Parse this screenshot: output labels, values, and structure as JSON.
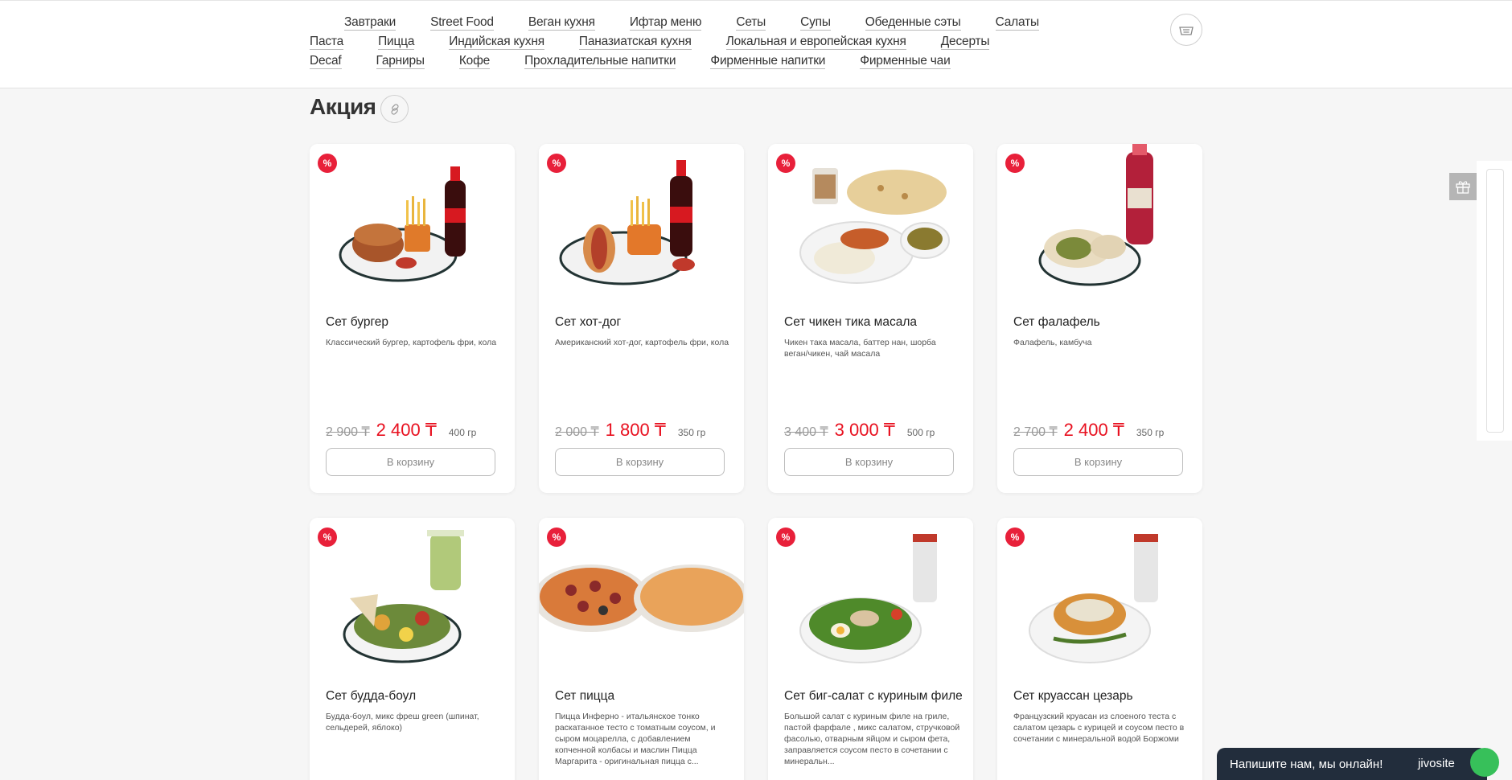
{
  "nav": {
    "row1": [
      "Завтраки",
      "Street Food",
      "Веган кухня",
      "Ифтар меню",
      "Сеты",
      "Супы",
      "Обеденные сэты",
      "Салаты"
    ],
    "row2": [
      "Паста",
      "Пицца",
      "Индийская кухня",
      "Паназиатская кухня",
      "Локальная и европейская кухня",
      "Десерты"
    ],
    "row3": [
      "Decaf",
      "Гарниры",
      "Кофе",
      "Прохладительные напитки",
      "Фирменные напитки",
      "Фирменные чаи"
    ]
  },
  "section": {
    "title": "Акция"
  },
  "badge_label": "%",
  "cart_button_label": "В корзину",
  "products": [
    {
      "name": "Сет бургер",
      "desc": "Классический бургер, картофель фри, кола",
      "old_price": "2 900 ₸",
      "price": "2 400 ₸",
      "weight": "400 гр"
    },
    {
      "name": "Сет хот-дог",
      "desc": "Американский хот-дог, картофель фри, кола",
      "old_price": "2 000 ₸",
      "price": "1 800 ₸",
      "weight": "350 гр"
    },
    {
      "name": "Сет чикен тика масала",
      "desc": "Чикен така масала, баттер нан, шорба веган/чикен, чай масала",
      "old_price": "3 400 ₸",
      "price": "3 000 ₸",
      "weight": "500 гр"
    },
    {
      "name": "Сет фалафель",
      "desc": "Фалафель, камбуча",
      "old_price": "2 700 ₸",
      "price": "2 400 ₸",
      "weight": "350 гр"
    },
    {
      "name": "Сет будда-боул",
      "desc": "Будда-боул, микс фреш green (шпинат, сельдерей, яблоко)"
    },
    {
      "name": "Сет пицца",
      "desc": "Пицца Инферно - итальянское тонко раскатанное тесто с томатным соусом, и сыром моцарелла, с добавлением копченной колбасы и маслин Пицца Маргарита - оригинальная пицца с..."
    },
    {
      "name": "Сет биг-салат с куриным филе",
      "desc": "Большой салат с куриным филе на гриле, пастой фарфале , микс салатом, стручковой фасолью, отварным яйцом и сыром фета, заправляется соусом песто в сочетании с минеральн..."
    },
    {
      "name": "Сет круассан цезарь",
      "desc": "Французский круасан из слоеного теста с салатом цезарь с курицей и соусом песто в сочетании с минеральной водой Боржоми"
    }
  ],
  "chat": {
    "text": "Напишите нам, мы онлайн!",
    "brand": "jivosite"
  },
  "colors": {
    "accent": "#e8101f",
    "badge": "#e8203a",
    "chat_bg": "#222d3c"
  }
}
